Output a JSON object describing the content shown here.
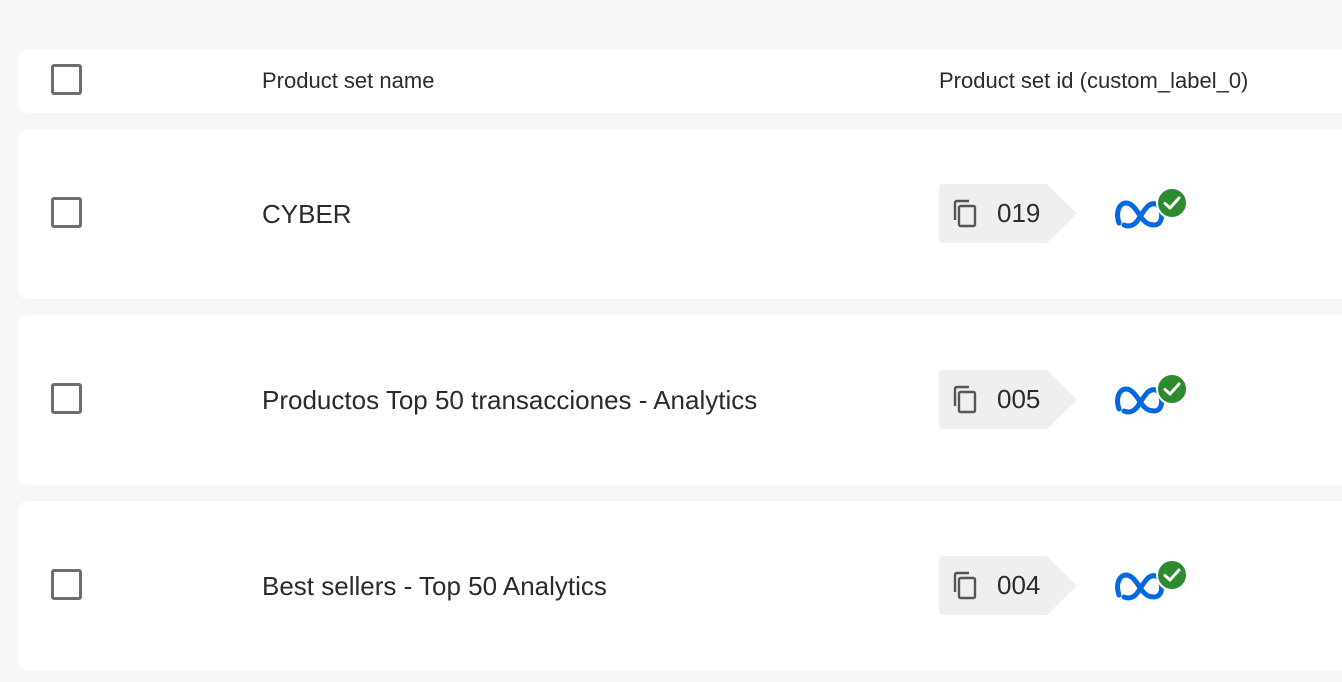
{
  "header": {
    "name_column": "Product set name",
    "id_column": "Product set id (custom_label_0)"
  },
  "rows": [
    {
      "name": "CYBER",
      "id": "019",
      "status_icon": "meta-verified-icon"
    },
    {
      "name": "Productos Top 50 transacciones - Analytics",
      "id": "005",
      "status_icon": "meta-verified-icon"
    },
    {
      "name": "Best sellers - Top 50 Analytics",
      "id": "004",
      "status_icon": "meta-verified-icon"
    }
  ],
  "colors": {
    "background": "#f7f7f7",
    "row": "#ffffff",
    "tag": "#efefef",
    "meta_blue": "#0668E1",
    "check_green": "#2e8a2e"
  }
}
